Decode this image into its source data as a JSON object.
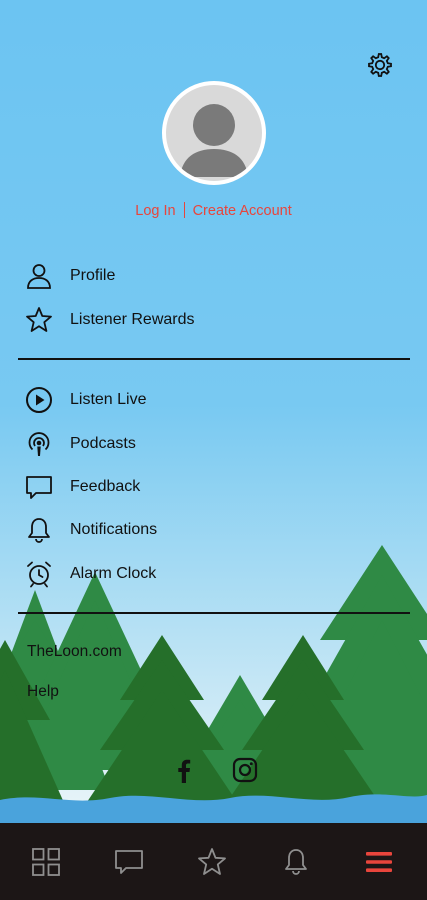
{
  "auth": {
    "login_label": "Log In",
    "create_account_label": "Create Account"
  },
  "menu": {
    "primary": [
      {
        "label": "Profile",
        "icon": "person-icon"
      },
      {
        "label": "Listener Rewards",
        "icon": "star-icon"
      }
    ],
    "secondary": [
      {
        "label": "Listen Live",
        "icon": "play-circle-icon"
      },
      {
        "label": "Podcasts",
        "icon": "podcast-icon"
      },
      {
        "label": "Feedback",
        "icon": "chat-bubble-icon"
      },
      {
        "label": "Notifications",
        "icon": "bell-icon"
      },
      {
        "label": "Alarm Clock",
        "icon": "alarm-clock-icon"
      }
    ]
  },
  "links": {
    "website": "TheLoon.com",
    "help": "Help"
  },
  "social": [
    "facebook-icon",
    "instagram-icon"
  ],
  "tabbar": {
    "tabs": [
      "grid-icon",
      "chat-bubble-icon",
      "star-icon",
      "bell-icon",
      "menu-icon"
    ],
    "active": "menu-icon"
  },
  "colors": {
    "sky_top": "#6cc4f2",
    "accent": "#e8453c",
    "tree_dark": "#256f2a",
    "tree_light": "#2f8a45",
    "water": "#4aa3dc",
    "tabbar_bg": "#1c1616"
  }
}
